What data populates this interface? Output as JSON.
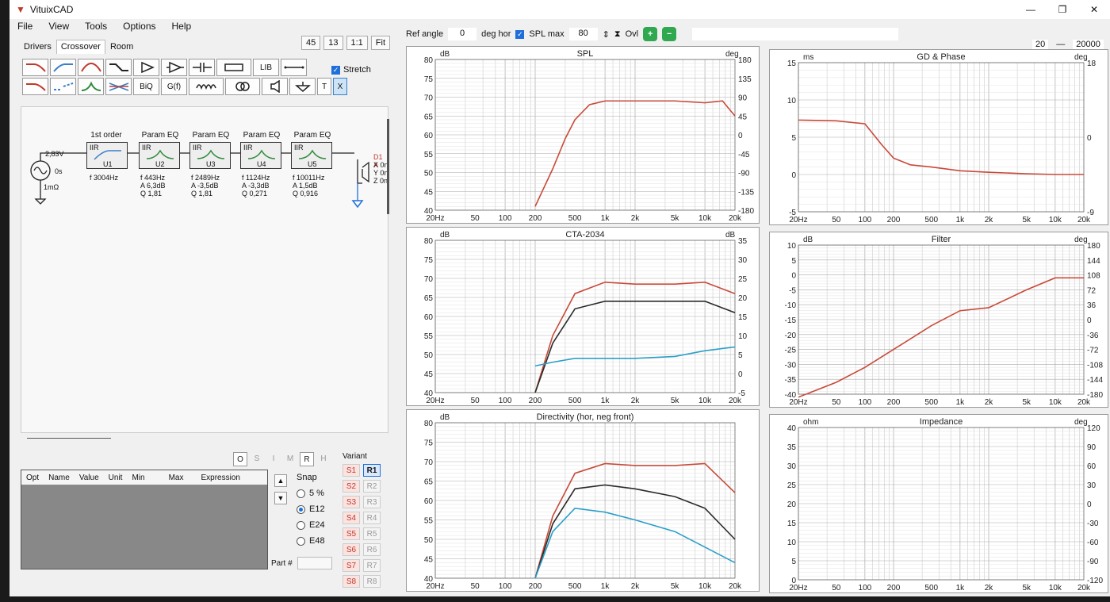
{
  "window": {
    "title": "VituixCAD",
    "icon": "vituixcad-logo-icon"
  },
  "menu": [
    "File",
    "View",
    "Tools",
    "Options",
    "Help"
  ],
  "tabs": [
    "Drivers",
    "Crossover",
    "Room"
  ],
  "zoom": {
    "a": "45",
    "b": "13",
    "c": "1:1",
    "d": "Fit"
  },
  "palette": {
    "stretch_label": "Stretch",
    "row1_text": [
      "LIB"
    ],
    "row2_text": [
      "BiQ",
      "G(f)",
      "T",
      "X"
    ]
  },
  "schematic": {
    "source": {
      "voltage": "2,83V",
      "delay": "0s",
      "impedance": "1mΩ"
    },
    "blocks": [
      {
        "title": "1st order",
        "type": "IIR",
        "id": "U1",
        "f": "f   3004Hz",
        "a": "",
        "q": ""
      },
      {
        "title": "Param EQ",
        "type": "IIR",
        "id": "U2",
        "f": "f   443Hz",
        "a": "A  6,3dB",
        "q": "Q  1,81"
      },
      {
        "title": "Param EQ",
        "type": "IIR",
        "id": "U3",
        "f": "f   2489Hz",
        "a": "A  -3,5dB",
        "q": "Q  1,81"
      },
      {
        "title": "Param EQ",
        "type": "IIR",
        "id": "U4",
        "f": "f   1124Hz",
        "a": "A  -3,3dB",
        "q": "Q  0,271"
      },
      {
        "title": "Param EQ",
        "type": "IIR",
        "id": "U5",
        "f": "f   10011Hz",
        "a": "A  1,5dB",
        "q": "Q  0,916"
      }
    ],
    "driver": {
      "name": "D1 A",
      "x": "X 0n",
      "y": "Y 0n",
      "z": "Z 0n"
    }
  },
  "lower": {
    "osmrh": [
      "O",
      "S",
      "I",
      "M",
      "R",
      "H"
    ],
    "grid_headers": [
      "Opt",
      "Name",
      "Value",
      "Unit",
      "Min",
      "Max",
      "Expression"
    ],
    "snap": {
      "title": "Snap",
      "options": [
        "5 %",
        "E12",
        "E24",
        "E48"
      ],
      "selected": "E12"
    },
    "part_label": "Part #",
    "variant": {
      "title": "Variant",
      "s": [
        "S1",
        "S2",
        "S3",
        "S4",
        "S5",
        "S6",
        "S7",
        "S8"
      ],
      "r": [
        "R1",
        "R2",
        "R3",
        "R4",
        "R5",
        "R6",
        "R7",
        "R8"
      ],
      "selected": "R1"
    }
  },
  "graph_toolbar": {
    "ref_angle_label": "Ref angle",
    "ref_angle": "0",
    "deg_hor": "deg hor",
    "spl_max_label": "SPL max",
    "spl_max": "80",
    "ovl": "Ovl",
    "plus": "+",
    "minus": "−"
  },
  "range": {
    "min": "20",
    "max": "20000",
    "unit": "H"
  },
  "chart_data": [
    {
      "type": "line",
      "title": "SPL",
      "ylabel": "dB",
      "y2label": "deg",
      "ylim": [
        40,
        80
      ],
      "y2lim": [
        -180,
        180
      ],
      "yticks": [
        "80",
        "75",
        "70",
        "65",
        "60",
        "55",
        "50",
        "45",
        "40"
      ],
      "y2ticks": [
        "180",
        "135",
        "90",
        "45",
        "0",
        "-45",
        "-90",
        "-135",
        "-180"
      ],
      "xticks": [
        "20Hz",
        "50",
        "100",
        "200",
        "500",
        "1k",
        "2k",
        "5k",
        "10k",
        "20k"
      ],
      "x": [
        200,
        300,
        400,
        500,
        700,
        1000,
        2000,
        5000,
        10000,
        15000,
        20000
      ],
      "series": [
        {
          "values": [
            41,
            51,
            59,
            64,
            68,
            69,
            69,
            69,
            68.5,
            69,
            65
          ]
        }
      ]
    },
    {
      "type": "line",
      "title": "GD & Phase",
      "ylabel": "ms",
      "y2label": "deg",
      "ylim": [
        -5,
        15
      ],
      "y2lim": [
        -180,
        180
      ],
      "yticks": [
        "15",
        "10",
        "5",
        "0",
        "-5"
      ],
      "y2ticks": [
        "18",
        "0",
        "-9"
      ],
      "xticks": [
        "20Hz",
        "50",
        "100",
        "200",
        "500",
        "1k",
        "2k",
        "5k",
        "10k",
        "20k"
      ],
      "x": [
        20,
        50,
        100,
        150,
        200,
        300,
        500,
        1000,
        2000,
        5000,
        10000,
        20000
      ],
      "series": [
        {
          "values": [
            7.3,
            7.2,
            6.8,
            4,
            2.2,
            1.3,
            1,
            0.5,
            0.3,
            0.1,
            0,
            0
          ]
        }
      ]
    },
    {
      "type": "line",
      "title": "CTA-2034",
      "ylabel": "dB",
      "y2label": "dB",
      "ylim": [
        40,
        80
      ],
      "y2lim": [
        -5,
        35
      ],
      "yticks": [
        "80",
        "75",
        "70",
        "65",
        "60",
        "55",
        "50",
        "45",
        "40"
      ],
      "y2ticks": [
        "35",
        "30",
        "25",
        "20",
        "15",
        "10",
        "5",
        "0",
        "-5"
      ],
      "xticks": [
        "20Hz",
        "50",
        "100",
        "200",
        "500",
        "1k",
        "2k",
        "5k",
        "10k",
        "20k"
      ],
      "x": [
        200,
        300,
        500,
        1000,
        2000,
        5000,
        10000,
        20000
      ],
      "series": [
        {
          "values": [
            40,
            55,
            66,
            69,
            68.5,
            68.5,
            69,
            66
          ]
        },
        {
          "values": [
            40,
            53,
            62,
            64,
            64,
            64,
            64,
            61
          ]
        },
        {
          "values": [
            47,
            48,
            49,
            49,
            49,
            49.5,
            51,
            52
          ]
        }
      ]
    },
    {
      "type": "line",
      "title": "Filter",
      "ylabel": "dB",
      "y2label": "deg",
      "ylim": [
        -40,
        10
      ],
      "y2lim": [
        -180,
        180
      ],
      "yticks": [
        "10",
        "5",
        "0",
        "-5",
        "-10",
        "-15",
        "-20",
        "-25",
        "-30",
        "-35",
        "-40"
      ],
      "y2ticks": [
        "180",
        "144",
        "108",
        "72",
        "36",
        "0",
        "-36",
        "-72",
        "-108",
        "-144",
        "-180"
      ],
      "xticks": [
        "20Hz",
        "50",
        "100",
        "200",
        "500",
        "1k",
        "2k",
        "5k",
        "10k",
        "20k"
      ],
      "x": [
        20,
        50,
        100,
        200,
        500,
        1000,
        2000,
        5000,
        10000,
        20000
      ],
      "series": [
        {
          "values": [
            -41,
            -36,
            -31,
            -25,
            -17,
            -12,
            -11,
            -5,
            -1,
            -1
          ]
        }
      ]
    },
    {
      "type": "line",
      "title": "Directivity (hor, neg front)",
      "ylabel": "dB",
      "ylim": [
        40,
        80
      ],
      "yticks": [
        "80",
        "75",
        "70",
        "65",
        "60",
        "55",
        "50",
        "45",
        "40"
      ],
      "xticks": [
        "20Hz",
        "50",
        "100",
        "200",
        "500",
        "1k",
        "2k",
        "5k",
        "10k",
        "20k"
      ],
      "x": [
        200,
        300,
        500,
        1000,
        2000,
        5000,
        10000,
        20000
      ],
      "series": [
        {
          "values": [
            40,
            56,
            67,
            69.5,
            69,
            69,
            69.5,
            62
          ]
        },
        {
          "values": [
            40,
            54,
            63,
            64,
            63,
            61,
            58,
            50
          ]
        },
        {
          "values": [
            40,
            52,
            58,
            57,
            55,
            52,
            48,
            44
          ]
        }
      ]
    },
    {
      "type": "line",
      "title": "Impedance",
      "ylabel": "ohm",
      "y2label": "deg",
      "ylim": [
        0,
        40
      ],
      "y2lim": [
        -120,
        120
      ],
      "yticks": [
        "40",
        "35",
        "30",
        "25",
        "20",
        "15",
        "10",
        "5",
        "0"
      ],
      "y2ticks": [
        "120",
        "90",
        "60",
        "30",
        "0",
        "-30",
        "-60",
        "-90",
        "-120"
      ],
      "xticks": [
        "20Hz",
        "50",
        "100",
        "200",
        "500",
        "1k",
        "2k",
        "5k",
        "10k",
        "20k"
      ],
      "x": [],
      "series": []
    }
  ]
}
